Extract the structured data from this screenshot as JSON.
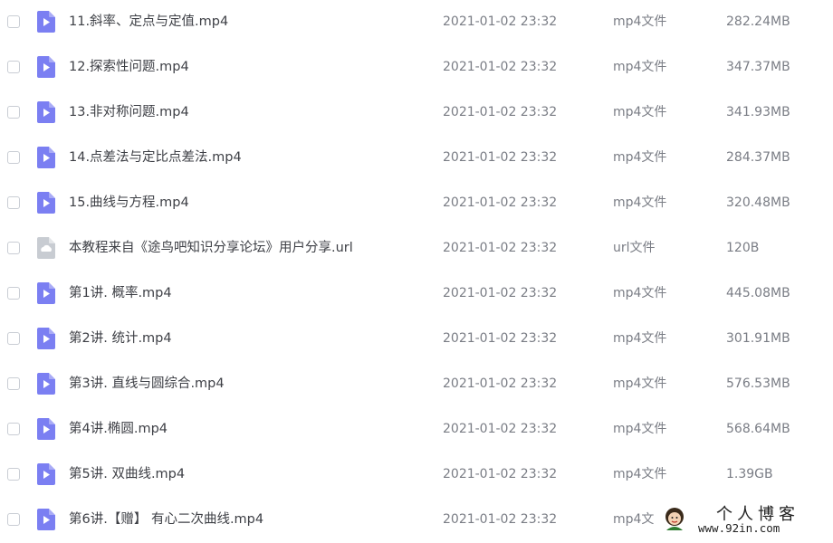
{
  "colors": {
    "video_icon": "#7b7ff2",
    "url_icon": "#c8ccd2",
    "name_text": "#3d3f45",
    "meta_text": "#7a7d85"
  },
  "files": [
    {
      "icon": "video-file-icon",
      "name": "11.斜率、定点与定值.mp4",
      "date": "2021-01-02 23:32",
      "type": "mp4文件",
      "size": "282.24MB"
    },
    {
      "icon": "video-file-icon",
      "name": "12.探索性问题.mp4",
      "date": "2021-01-02 23:32",
      "type": "mp4文件",
      "size": "347.37MB"
    },
    {
      "icon": "video-file-icon",
      "name": "13.非对称问题.mp4",
      "date": "2021-01-02 23:32",
      "type": "mp4文件",
      "size": "341.93MB"
    },
    {
      "icon": "video-file-icon",
      "name": "14.点差法与定比点差法.mp4",
      "date": "2021-01-02 23:32",
      "type": "mp4文件",
      "size": "284.37MB"
    },
    {
      "icon": "video-file-icon",
      "name": "15.曲线与方程.mp4",
      "date": "2021-01-02 23:32",
      "type": "mp4文件",
      "size": "320.48MB"
    },
    {
      "icon": "url-file-icon",
      "name": "本教程来自《途鸟吧知识分享论坛》用户分享.url",
      "date": "2021-01-02 23:32",
      "type": "url文件",
      "size": "120B"
    },
    {
      "icon": "video-file-icon",
      "name": "第1讲. 概率.mp4",
      "date": "2021-01-02 23:32",
      "type": "mp4文件",
      "size": "445.08MB"
    },
    {
      "icon": "video-file-icon",
      "name": "第2讲. 统计.mp4",
      "date": "2021-01-02 23:32",
      "type": "mp4文件",
      "size": "301.91MB"
    },
    {
      "icon": "video-file-icon",
      "name": "第3讲. 直线与圆综合.mp4",
      "date": "2021-01-02 23:32",
      "type": "mp4文件",
      "size": "576.53MB"
    },
    {
      "icon": "video-file-icon",
      "name": "第4讲.椭圆.mp4",
      "date": "2021-01-02 23:32",
      "type": "mp4文件",
      "size": "568.64MB"
    },
    {
      "icon": "video-file-icon",
      "name": "第5讲. 双曲线.mp4",
      "date": "2021-01-02 23:32",
      "type": "mp4文件",
      "size": "1.39GB"
    },
    {
      "icon": "video-file-icon",
      "name": "第6讲.【赠】 有心二次曲线.mp4",
      "date": "2021-01-02 23:32",
      "type": "mp4文",
      "size": ""
    }
  ],
  "watermark": {
    "title": "个人博客",
    "url": "www.92in.com"
  }
}
